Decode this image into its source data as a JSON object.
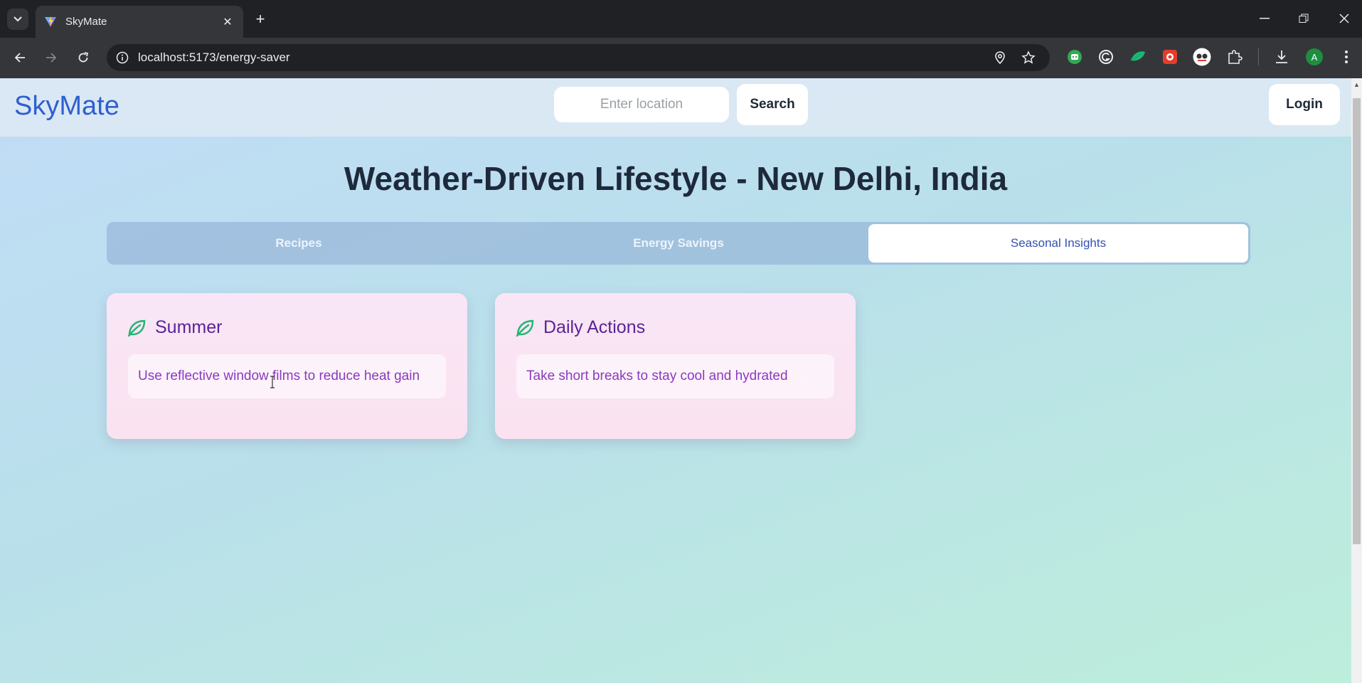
{
  "browser": {
    "tab_title": "SkyMate",
    "url": "localhost:5173/energy-saver",
    "profile_initial": "A"
  },
  "header": {
    "brand": "SkyMate",
    "search_placeholder": "Enter location",
    "search_label": "Search",
    "login_label": "Login"
  },
  "main": {
    "title": "Weather-Driven Lifestyle - New Delhi, India",
    "tabs": [
      {
        "label": "Recipes",
        "active": false
      },
      {
        "label": "Energy Savings",
        "active": false
      },
      {
        "label": "Seasonal Insights",
        "active": true
      }
    ],
    "cards": [
      {
        "title": "Summer",
        "tip": "Use reflective window films to reduce heat gain",
        "icon": "leaf-icon"
      },
      {
        "title": "Daily Actions",
        "tip": "Take short breaks to stay cool and hydrated",
        "icon": "leaf-icon"
      }
    ]
  },
  "colors": {
    "brand": "#2f5fd0",
    "card_title": "#5b2396",
    "card_text": "#8a3ac0",
    "leaf": "#22b573",
    "active_tab_text": "#3550b0"
  }
}
